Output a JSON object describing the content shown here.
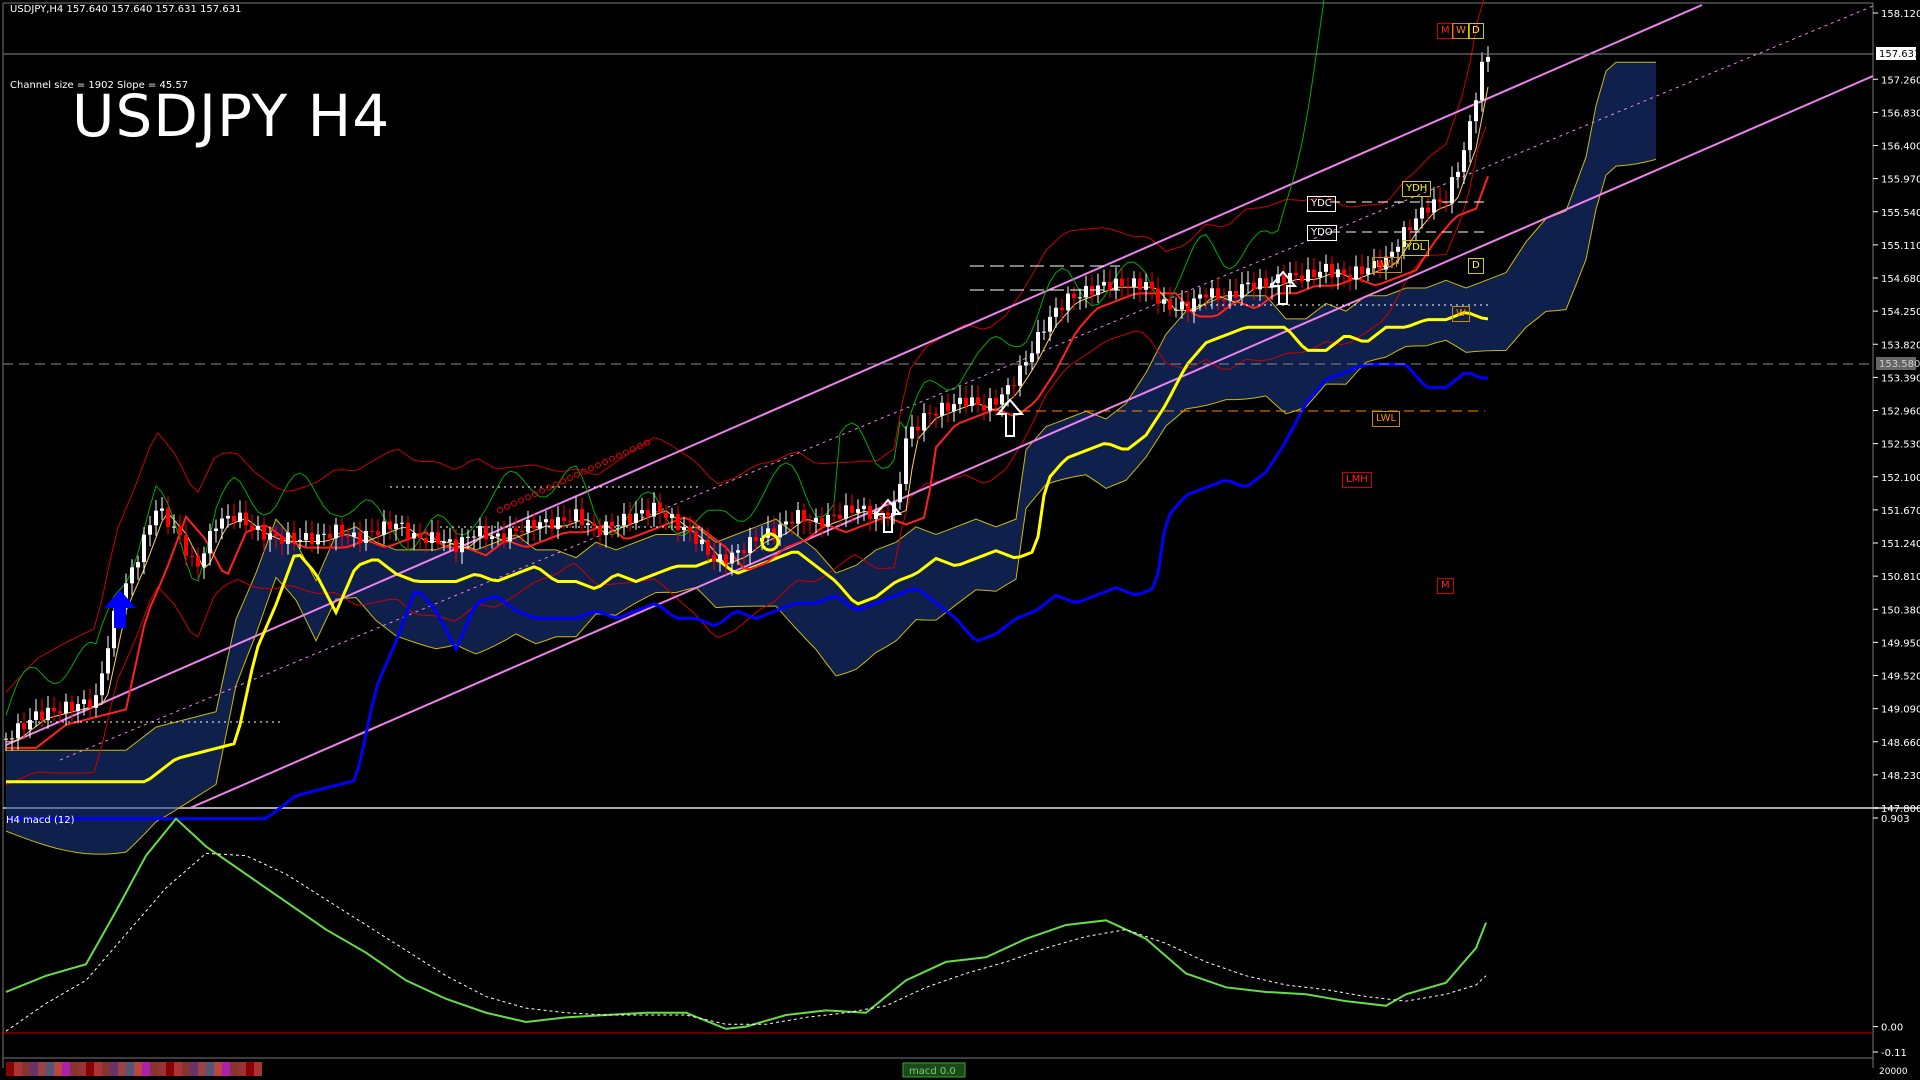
{
  "header": {
    "symbol_line": "USDJPY,H4  157.640 157.640 157.631 157.631",
    "channel_info": "Channel size = 1902 Slope = 45.57",
    "big_title": "USDJPY H4",
    "macd_label": "H4  macd (12)",
    "bottom_tab": "macd 0.0"
  },
  "markers": {
    "mwd": [
      "M",
      "W",
      "D"
    ],
    "ydc": "YDC",
    "ydo": "YDO",
    "ydh": "YDH",
    "ydl": "YDL",
    "lwh": "LWH",
    "d2": "D",
    "w2": "W",
    "lwl": "LWL",
    "lmh": "LMH",
    "m2": "M"
  },
  "price_tags": {
    "current": "157.631",
    "dashed": "153.580"
  },
  "colors": {
    "background": "#000000",
    "channel": "#ee82ee",
    "ma_yellow": "#ffff00",
    "ma_blue": "#0000ff",
    "rsi_green": "#00aa00",
    "macd_main": "#66dd44",
    "macd_signal": "#ffffff",
    "bull": "#ffffff",
    "bear": "#ff0000",
    "cloud": "#1e3a8a"
  },
  "chart_data": [
    {
      "type": "candlestick",
      "yaxis_ticks": [
        "158.120",
        "157.260",
        "156.830",
        "156.400",
        "155.970",
        "155.540",
        "155.110",
        "154.680",
        "154.250",
        "153.820",
        "153.390",
        "152.960",
        "152.530",
        "152.100",
        "151.670",
        "151.240",
        "150.810",
        "150.380",
        "149.950",
        "149.520",
        "149.090",
        "148.660",
        "148.230",
        "147.800"
      ],
      "ylim": [
        147.8,
        158.12
      ],
      "close_path": [
        [
          0,
          148.7
        ],
        [
          30,
          149.0
        ],
        [
          60,
          149.1
        ],
        [
          90,
          149.2
        ],
        [
          110,
          150.4
        ],
        [
          130,
          151.0
        ],
        [
          150,
          151.7
        ],
        [
          170,
          151.4
        ],
        [
          190,
          150.9
        ],
        [
          210,
          151.5
        ],
        [
          230,
          151.6
        ],
        [
          250,
          151.4
        ],
        [
          270,
          151.3
        ],
        [
          290,
          151.3
        ],
        [
          310,
          151.3
        ],
        [
          330,
          151.4
        ],
        [
          350,
          151.3
        ],
        [
          370,
          151.4
        ],
        [
          390,
          151.5
        ],
        [
          410,
          151.3
        ],
        [
          430,
          151.3
        ],
        [
          450,
          151.2
        ],
        [
          470,
          151.4
        ],
        [
          490,
          151.3
        ],
        [
          510,
          151.4
        ],
        [
          530,
          151.5
        ],
        [
          550,
          151.5
        ],
        [
          570,
          151.6
        ],
        [
          590,
          151.4
        ],
        [
          610,
          151.5
        ],
        [
          630,
          151.6
        ],
        [
          650,
          151.7
        ],
        [
          670,
          151.5
        ],
        [
          690,
          151.3
        ],
        [
          710,
          151.0
        ],
        [
          730,
          151.1
        ],
        [
          750,
          151.3
        ],
        [
          770,
          151.4
        ],
        [
          790,
          151.6
        ],
        [
          810,
          151.5
        ],
        [
          830,
          151.6
        ],
        [
          850,
          151.7
        ],
        [
          870,
          151.6
        ],
        [
          890,
          151.7
        ],
        [
          900,
          152.6
        ],
        [
          920,
          152.9
        ],
        [
          940,
          153.0
        ],
        [
          960,
          153.1
        ],
        [
          980,
          153.0
        ],
        [
          1000,
          153.2
        ],
        [
          1020,
          153.6
        ],
        [
          1040,
          154.1
        ],
        [
          1060,
          154.4
        ],
        [
          1080,
          154.5
        ],
        [
          1100,
          154.6
        ],
        [
          1120,
          154.6
        ],
        [
          1140,
          154.6
        ],
        [
          1160,
          154.3
        ],
        [
          1180,
          154.3
        ],
        [
          1200,
          154.5
        ],
        [
          1220,
          154.4
        ],
        [
          1240,
          154.6
        ],
        [
          1260,
          154.6
        ],
        [
          1280,
          154.7
        ],
        [
          1300,
          154.7
        ],
        [
          1320,
          154.8
        ],
        [
          1340,
          154.7
        ],
        [
          1360,
          154.8
        ],
        [
          1380,
          154.9
        ],
        [
          1400,
          155.3
        ],
        [
          1420,
          155.6
        ],
        [
          1440,
          155.7
        ],
        [
          1460,
          156.4
        ],
        [
          1475,
          157.4
        ],
        [
          1485,
          157.63
        ]
      ]
    },
    {
      "type": "line",
      "title": "macd (12)",
      "yaxis_ticks": [
        "0.903",
        "0.00",
        "-0.11"
      ],
      "ylim": [
        -0.11,
        0.903
      ],
      "series": [
        {
          "values": [
            [
              0,
              0.15
            ],
            [
              40,
              0.22
            ],
            [
              80,
              0.27
            ],
            [
              110,
              0.5
            ],
            [
              140,
              0.74
            ],
            [
              170,
              0.9
            ],
            [
              200,
              0.78
            ],
            [
              240,
              0.66
            ],
            [
              280,
              0.54
            ],
            [
              320,
              0.42
            ],
            [
              360,
              0.32
            ],
            [
              400,
              0.2
            ],
            [
              440,
              0.12
            ],
            [
              480,
              0.06
            ],
            [
              520,
              0.02
            ],
            [
              560,
              0.04
            ],
            [
              600,
              0.05
            ],
            [
              640,
              0.06
            ],
            [
              680,
              0.06
            ],
            [
              720,
              -0.01
            ],
            [
              740,
              0.0
            ],
            [
              780,
              0.05
            ],
            [
              820,
              0.07
            ],
            [
              860,
              0.06
            ],
            [
              900,
              0.2
            ],
            [
              940,
              0.28
            ],
            [
              980,
              0.3
            ],
            [
              1020,
              0.38
            ],
            [
              1060,
              0.44
            ],
            [
              1100,
              0.46
            ],
            [
              1140,
              0.38
            ],
            [
              1180,
              0.23
            ],
            [
              1220,
              0.17
            ],
            [
              1260,
              0.15
            ],
            [
              1300,
              0.14
            ],
            [
              1340,
              0.11
            ],
            [
              1380,
              0.09
            ],
            [
              1400,
              0.14
            ],
            [
              1440,
              0.19
            ],
            [
              1470,
              0.34
            ],
            [
              1480,
              0.45
            ]
          ]
        },
        {
          "values": [
            [
              0,
              -0.02
            ],
            [
              40,
              0.1
            ],
            [
              80,
              0.2
            ],
            [
              120,
              0.4
            ],
            [
              160,
              0.6
            ],
            [
              200,
              0.75
            ],
            [
              240,
              0.74
            ],
            [
              280,
              0.66
            ],
            [
              320,
              0.55
            ],
            [
              360,
              0.44
            ],
            [
              400,
              0.33
            ],
            [
              440,
              0.22
            ],
            [
              480,
              0.13
            ],
            [
              520,
              0.08
            ],
            [
              560,
              0.06
            ],
            [
              600,
              0.05
            ],
            [
              640,
              0.05
            ],
            [
              680,
              0.05
            ],
            [
              720,
              0.01
            ],
            [
              760,
              0.01
            ],
            [
              800,
              0.04
            ],
            [
              840,
              0.06
            ],
            [
              880,
              0.09
            ],
            [
              920,
              0.17
            ],
            [
              960,
              0.23
            ],
            [
              1000,
              0.28
            ],
            [
              1040,
              0.34
            ],
            [
              1080,
              0.39
            ],
            [
              1120,
              0.42
            ],
            [
              1160,
              0.36
            ],
            [
              1200,
              0.28
            ],
            [
              1240,
              0.22
            ],
            [
              1280,
              0.18
            ],
            [
              1320,
              0.16
            ],
            [
              1360,
              0.13
            ],
            [
              1400,
              0.11
            ],
            [
              1440,
              0.14
            ],
            [
              1470,
              0.18
            ],
            [
              1480,
              0.22
            ]
          ]
        }
      ]
    }
  ]
}
